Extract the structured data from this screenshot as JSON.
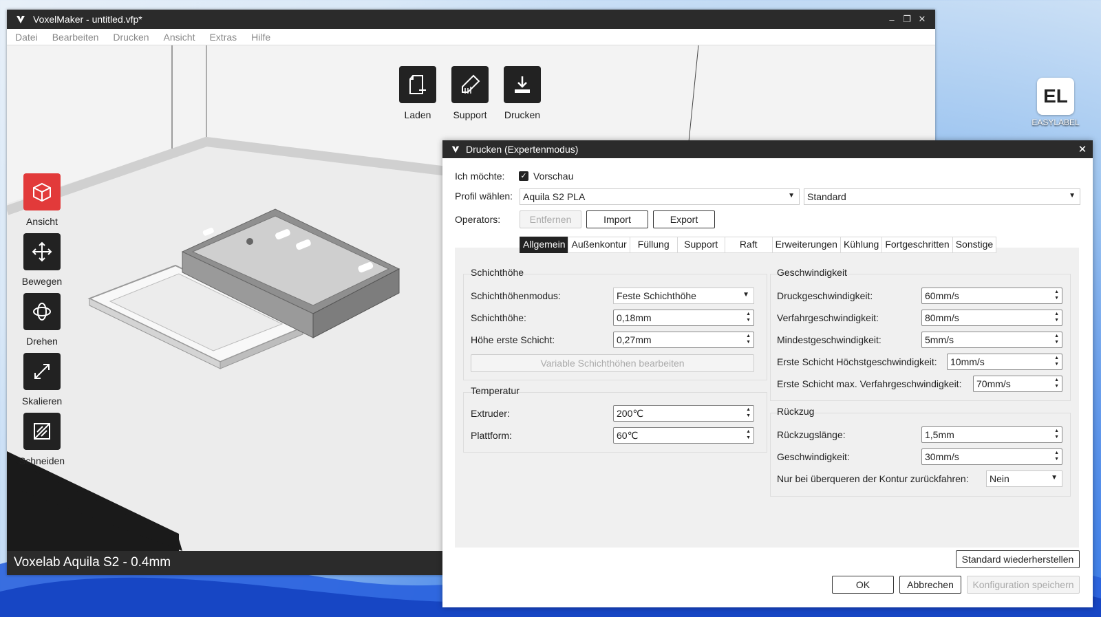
{
  "app": {
    "title": "VoxelMaker - untitled.vfp*",
    "menu": [
      "Datei",
      "Bearbeiten",
      "Drucken",
      "Ansicht",
      "Extras",
      "Hilfe"
    ],
    "toolbar": {
      "laden": "Laden",
      "support": "Support",
      "drucken": "Drucken"
    },
    "side_tools": {
      "ansicht": "Ansicht",
      "bewegen": "Bewegen",
      "drehen": "Drehen",
      "skalieren": "Skalieren",
      "schneiden": "Schneiden"
    },
    "status": "Voxelab Aquila S2 - 0.4mm"
  },
  "desktop": {
    "icon_label": "EASYLABEL",
    "icon_text": "EL"
  },
  "dialog": {
    "title": "Drucken (Expertenmodus)",
    "ich_moechte_label": "Ich möchte:",
    "vorschau_label": "Vorschau",
    "profil_label": "Profil wählen:",
    "profil_value": "Aquila S2 PLA",
    "profil_variant": "Standard",
    "operators_label": "Operators:",
    "entfernen": "Entfernen",
    "import": "Import",
    "export": "Export",
    "tabs": [
      "Allgemein",
      "Außenkontur",
      "Füllung",
      "Support",
      "Raft",
      "Erweiterungen",
      "Kühlung",
      "Fortgeschritten",
      "Sonstige"
    ],
    "schichthoehe": {
      "title": "Schichthöhe",
      "modus_label": "Schichthöhenmodus:",
      "modus_value": "Feste Schichthöhe",
      "hoehe_label": "Schichthöhe:",
      "hoehe_value": "0,18mm",
      "erste_label": "Höhe erste Schicht:",
      "erste_value": "0,27mm",
      "variable_btn": "Variable Schichthöhen bearbeiten"
    },
    "temperatur": {
      "title": "Temperatur",
      "extruder_label": "Extruder:",
      "extruder_value": "200℃",
      "plattform_label": "Plattform:",
      "plattform_value": "60℃"
    },
    "geschwindigkeit": {
      "title": "Geschwindigkeit",
      "druck_label": "Druckgeschwindigkeit:",
      "druck_value": "60mm/s",
      "verfahr_label": "Verfahrgeschwindigkeit:",
      "verfahr_value": "80mm/s",
      "mindest_label": "Mindestgeschwindigkeit:",
      "mindest_value": "5mm/s",
      "erste_hoechst_label": "Erste Schicht Höchstgeschwindigkeit:",
      "erste_hoechst_value": "10mm/s",
      "erste_verfahr_label": "Erste Schicht max. Verfahrgeschwindigkeit:",
      "erste_verfahr_value": "70mm/s"
    },
    "rueckzug": {
      "title": "Rückzug",
      "laenge_label": "Rückzugslänge:",
      "laenge_value": "1,5mm",
      "geschw_label": "Geschwindigkeit:",
      "geschw_value": "30mm/s",
      "kontur_label": "Nur bei überqueren der Kontur zurückfahren:",
      "kontur_value": "Nein"
    },
    "standard_btn": "Standard wiederherstellen",
    "ok_btn": "OK",
    "abbrechen_btn": "Abbrechen",
    "speichern_btn": "Konfiguration speichern"
  }
}
